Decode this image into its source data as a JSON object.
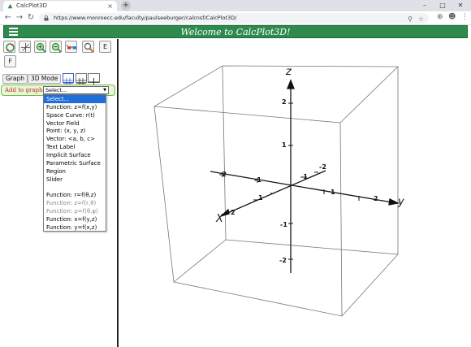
{
  "browser": {
    "tab_title": "CalcPlot3D",
    "tab_close": "×",
    "new_tab": "+",
    "window_controls": [
      "–",
      "□",
      "✕"
    ],
    "url": "https://www.monroecc.edu/faculty/paulseeburger/calcnsf/CalcPlot3D/",
    "nav": {
      "back": "←",
      "forward": "→",
      "reload": "↻"
    },
    "omnibox_icons": [
      "⚲",
      "☆"
    ],
    "toolbar_icons": [
      "⊕",
      "☻",
      "⋮"
    ]
  },
  "app": {
    "title": "Welcome to CalcPlot3D!",
    "toolbar_letters": {
      "e": "E",
      "f": "F"
    },
    "mode_buttons": {
      "graph": "Graph",
      "mode3d": "3D Mode"
    },
    "add_to_graph": {
      "label": "Add to graph:",
      "selected": "Select...",
      "options": [
        {
          "text": "Select...",
          "state": "highlighted"
        },
        {
          "text": "Function: z=f(x,y)",
          "state": "normal"
        },
        {
          "text": "Space Curve: r(t)",
          "state": "normal"
        },
        {
          "text": "Vector Field",
          "state": "normal"
        },
        {
          "text": "Point: (x, y, z)",
          "state": "normal"
        },
        {
          "text": "Vector: <a, b, c>",
          "state": "normal"
        },
        {
          "text": "Text Label",
          "state": "normal"
        },
        {
          "text": "Implicit Surface",
          "state": "normal"
        },
        {
          "text": "Parametric Surface",
          "state": "normal"
        },
        {
          "text": "Region",
          "state": "normal"
        },
        {
          "text": "Slider",
          "state": "normal"
        },
        {
          "text": "",
          "state": "spacer"
        },
        {
          "text": "Function: r=f(θ,z)",
          "state": "normal"
        },
        {
          "text": "Function: z=f(r,θ)",
          "state": "disabled"
        },
        {
          "text": "Function: ρ=f(θ,φ)",
          "state": "disabled"
        },
        {
          "text": "Function: x=f(y,z)",
          "state": "normal"
        },
        {
          "text": "Function: y=f(x,z)",
          "state": "normal"
        }
      ]
    }
  },
  "plot": {
    "axis_labels": {
      "x": "X",
      "y": "y",
      "z": "z"
    },
    "x_ticks": [
      "-2",
      "-1",
      "1",
      "2"
    ],
    "y_ticks": [
      "-2",
      "-1",
      "1",
      "2"
    ],
    "z_ticks": [
      "2",
      "1",
      "-1",
      "-2"
    ]
  }
}
